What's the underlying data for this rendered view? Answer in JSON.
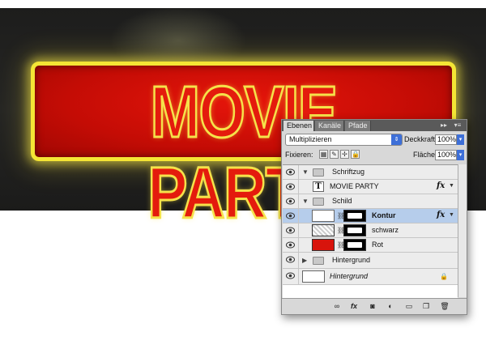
{
  "banner": {
    "title": "MOVIE PARTY"
  },
  "panel": {
    "tabs": [
      "Ebenen",
      "Kanäle",
      "Pfade"
    ],
    "active_tab": "Ebenen",
    "collapse_icon": "double-chevron-right-icon",
    "menu_icon": "panel-menu-icon",
    "blend_mode": "Multiplizieren",
    "opacity_label": "Deckkraft:",
    "opacity_value": "100%",
    "lock_label": "Fixieren:",
    "fill_label": "Fläche:",
    "fill_value": "100%"
  },
  "layers": [
    {
      "name": "Schriftzug",
      "type": "group",
      "expanded": true
    },
    {
      "name": "MOVIE PARTY",
      "type": "text",
      "fx": "fx"
    },
    {
      "name": "Schild",
      "type": "group",
      "expanded": true
    },
    {
      "name": "Kontur",
      "type": "layer",
      "selected": true,
      "fx": "fx"
    },
    {
      "name": "schwarz",
      "type": "layer"
    },
    {
      "name": "Rot",
      "type": "layer"
    },
    {
      "name": "Hintergrund",
      "type": "group",
      "expanded": false
    },
    {
      "name": "Hintergrund",
      "type": "background",
      "locked": true
    }
  ],
  "footer_icons": [
    "link-icon",
    "fx-icon",
    "mask-icon",
    "adjustment-icon",
    "folder-icon",
    "new-layer-icon",
    "trash-icon"
  ],
  "colors": {
    "sign_red": "#c40c05",
    "sign_border": "#f4e535",
    "selection": "#b6cdeb"
  }
}
